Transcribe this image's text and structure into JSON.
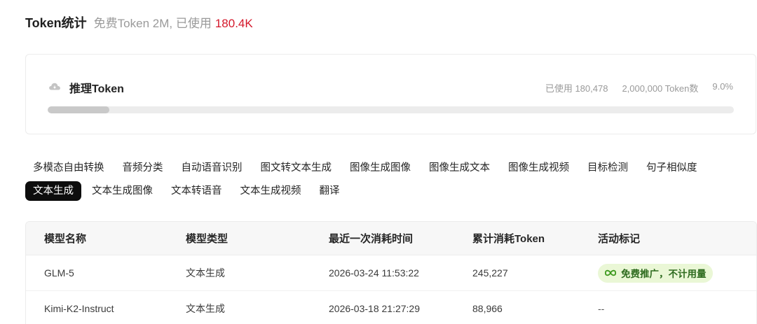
{
  "header": {
    "title": "Token统计",
    "subtitle": "免费Token 2M, 已使用",
    "used": "180.4K"
  },
  "usage_card": {
    "icon": "cloud-icon",
    "title": "推理Token",
    "used_label": "已使用 180,478",
    "total_label": "2,000,000 Token数",
    "percent_label": "9.0%",
    "progress_fraction": 0.09
  },
  "tabs": {
    "row1": [
      "多模态自由转换",
      "音频分类",
      "自动语音识别",
      "图文转文本生成",
      "图像生成图像",
      "图像生成文本",
      "图像生成视频",
      "目标检测",
      "句子相似度"
    ],
    "row2": [
      "文本生成",
      "文本生成图像",
      "文本转语音",
      "文本生成视频",
      "翻译"
    ],
    "active": "文本生成"
  },
  "table": {
    "headers": [
      "模型名称",
      "模型类型",
      "最近一次消耗时间",
      "累计消耗Token",
      "活动标记"
    ],
    "rows": [
      {
        "name": "GLM-5",
        "type": "文本生成",
        "time": "2026-03-24 11:53:22",
        "tokens": "245,227",
        "tag": "免费推广，不计用量"
      },
      {
        "name": "Kimi-K2-Instruct",
        "type": "文本生成",
        "time": "2026-03-18 21:27:29",
        "tokens": "88,966",
        "tag": "--"
      }
    ]
  },
  "colors": {
    "accent_red": "#d4182b",
    "badge_bg": "#eaf7d6",
    "badge_text": "#2e6b1f",
    "active_tab_bg": "#0d0d0d"
  }
}
